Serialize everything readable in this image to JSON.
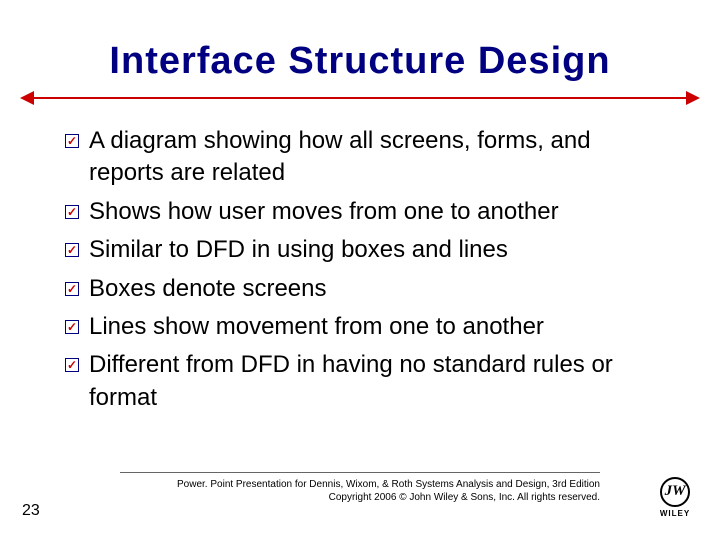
{
  "title": "Interface Structure Design",
  "bullets": [
    "A diagram showing how all screens, forms, and reports are related",
    "Shows how user moves from one to another",
    "Similar to DFD in using boxes and lines",
    "Boxes denote screens",
    "Lines show movement from one to another",
    "Different from DFD in having no standard rules or format"
  ],
  "footer": {
    "line1": "Power. Point Presentation for Dennis, Wixom, & Roth Systems Analysis and Design, 3rd Edition",
    "line2": "Copyright 2006 © John Wiley & Sons, Inc.  All rights reserved."
  },
  "page_number": "23",
  "logo": {
    "symbol": "JW",
    "name": "WILEY"
  }
}
